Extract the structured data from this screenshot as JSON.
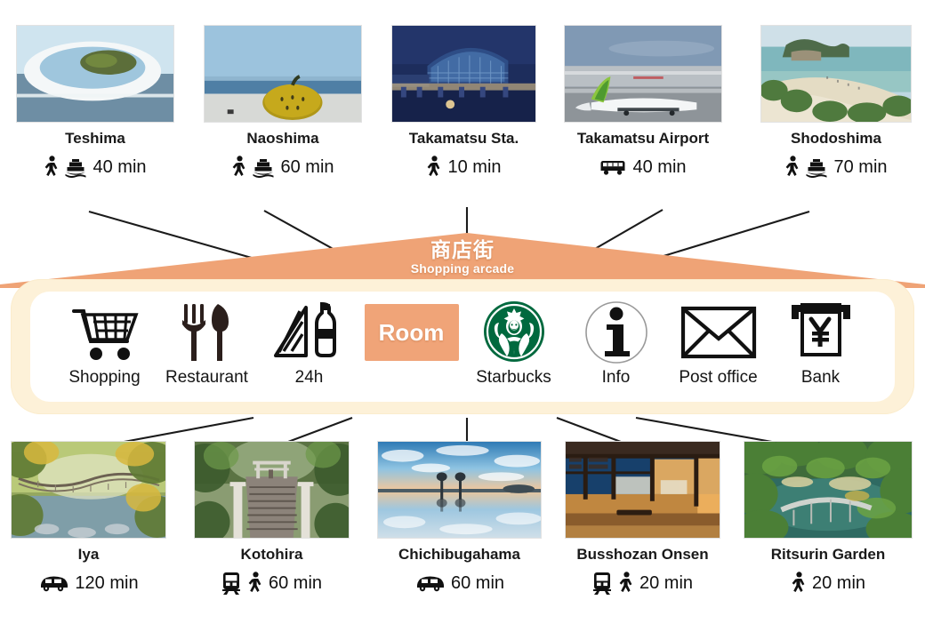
{
  "arcade": {
    "title_jp": "商店街",
    "title_en": "Shopping arcade",
    "color": "#efa376"
  },
  "facilities": [
    {
      "id": "shopping",
      "label": "Shopping",
      "icon": "shopping-cart-icon"
    },
    {
      "id": "restaurant",
      "label": "Restaurant",
      "icon": "fork-knife-icon"
    },
    {
      "id": "24h",
      "label": "24h",
      "icon": "sandwich-bottle-icon"
    },
    {
      "id": "room",
      "label": "Room",
      "icon": "room-box"
    },
    {
      "id": "starbucks",
      "label": "Starbucks",
      "icon": "starbucks-siren-icon"
    },
    {
      "id": "info",
      "label": "Info",
      "icon": "information-circle-icon"
    },
    {
      "id": "post-office",
      "label": "Post office",
      "icon": "envelope-icon"
    },
    {
      "id": "bank",
      "label": "Bank",
      "icon": "yen-atm-icon"
    }
  ],
  "top_destinations": [
    {
      "id": "teshima",
      "name": "Teshima",
      "time": "40 min",
      "modes": [
        "walk",
        "ferry"
      ],
      "photo": "teshima-art-museum-photo"
    },
    {
      "id": "naoshima",
      "name": "Naoshima",
      "time": "60 min",
      "modes": [
        "walk",
        "ferry"
      ],
      "photo": "naoshima-pumpkin-photo"
    },
    {
      "id": "takamatsu-station",
      "name": "Takamatsu Sta.",
      "time": "10 min",
      "modes": [
        "walk"
      ],
      "photo": "takamatsu-station-photo"
    },
    {
      "id": "takamatsu-airport",
      "name": "Takamatsu Airport",
      "time": "40 min",
      "modes": [
        "bus"
      ],
      "photo": "takamatsu-airport-photo"
    },
    {
      "id": "shodoshima",
      "name": "Shodoshima",
      "time": "70 min",
      "modes": [
        "walk",
        "ferry"
      ],
      "photo": "shodoshima-angel-road-photo"
    }
  ],
  "bottom_destinations": [
    {
      "id": "iya",
      "name": "Iya",
      "time": "120 min",
      "modes": [
        "car"
      ],
      "photo": "iya-vine-bridge-photo"
    },
    {
      "id": "kotohira",
      "name": "Kotohira",
      "time": "60 min",
      "modes": [
        "train",
        "walk"
      ],
      "photo": "kotohira-stairs-photo"
    },
    {
      "id": "chichibugahama",
      "name": "Chichibugahama",
      "time": "60 min",
      "modes": [
        "car"
      ],
      "photo": "chichibugahama-beach-photo"
    },
    {
      "id": "busshozan-onsen",
      "name": "Busshozan Onsen",
      "time": "20 min",
      "modes": [
        "train",
        "walk"
      ],
      "photo": "busshozan-onsen-photo"
    },
    {
      "id": "ritsurin-garden",
      "name": "Ritsurin Garden",
      "time": "20 min",
      "modes": [
        "walk"
      ],
      "photo": "ritsurin-garden-photo"
    }
  ]
}
